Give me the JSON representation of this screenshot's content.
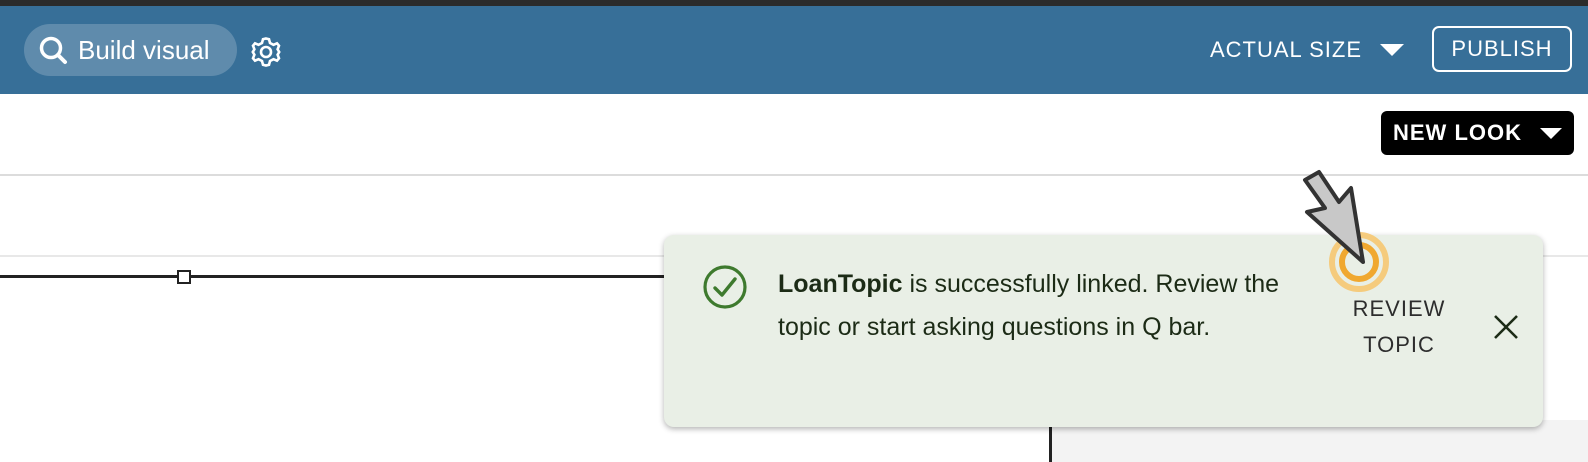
{
  "topbar": {
    "build_visual_label": "Build visual",
    "actual_size_label": "ACTUAL SIZE",
    "publish_label": "PUBLISH"
  },
  "sheet": {
    "new_look_label": "NEW LOOK"
  },
  "toast": {
    "topic_name": "LoanTopic",
    "message_rest": " is successfully linked. Review the topic or start asking questions in Q bar.",
    "review_line1": "REVIEW",
    "review_line2": "TOPIC"
  },
  "icons": {
    "search": "search-icon",
    "gear": "gear-icon",
    "caret": "chevron-down-icon",
    "check": "check-circle-icon",
    "close": "close-icon",
    "cursor": "pointer-cursor-icon"
  },
  "colors": {
    "topbar": "#376f98",
    "toast_bg": "#e9efe6",
    "success_green": "#3e7a2e",
    "highlight_orange": "#f0a830"
  }
}
